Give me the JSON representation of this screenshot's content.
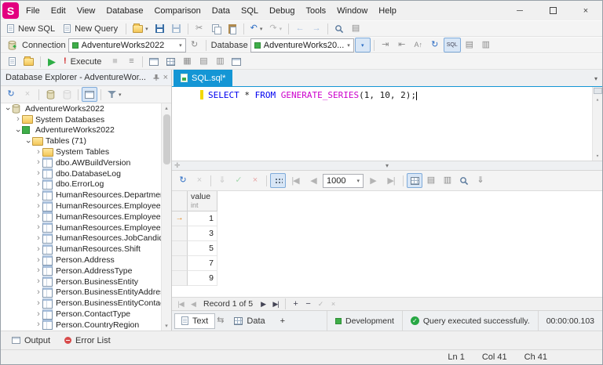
{
  "window": {
    "logo_text": "S",
    "menu_items": [
      "File",
      "Edit",
      "View",
      "Database",
      "Comparison",
      "Data",
      "SQL",
      "Debug",
      "Tools",
      "Window",
      "Help"
    ]
  },
  "icons": {
    "dropdown": "▾",
    "up": "▴",
    "chevron": "›",
    "refresh": "↻",
    "undo": "↶",
    "redo": "↷",
    "cut": "✂",
    "back": "←",
    "forward": "→",
    "play": "▶",
    "exclamation": "!",
    "lines": "≡",
    "stop": "■",
    "indent": "⇥",
    "outdent": "⇤",
    "uppercase": "A↑",
    "win1": "▦",
    "win2": "▤",
    "win3": "▥",
    "export": "⇓",
    "first": "|◀",
    "prev": "◀",
    "next": "▶",
    "last": "▶|",
    "plus": "+",
    "minus": "−",
    "check": "✓",
    "cross": "×",
    "minimize": "─",
    "swap": "⇆",
    "current_row": "→",
    "pin": "-□",
    "splitter_handle": "✛"
  },
  "colors": {
    "brand_pink": "#e3007f",
    "accent_tab_blue": "#1496d5",
    "status_green": "#3fae49",
    "keyword_blue": "#0000f0",
    "function_magenta": "#cc00cc",
    "changebar_yellow": "#f2d800"
  },
  "toolbars": {
    "new_sql": "New SQL",
    "new_query": "New Query",
    "connection_label": "Connection",
    "connection_value": "AdventureWorks2022",
    "database_label": "Database",
    "database_value": "AdventureWorks20...",
    "execute_label": "Execute",
    "sql_button": "SQL"
  },
  "explorer": {
    "title": "Database Explorer - AdventureWor...",
    "tree": [
      {
        "label": "AdventureWorks2022",
        "level": 0,
        "icon": "server",
        "state": "expanded"
      },
      {
        "label": "System Databases",
        "level": 1,
        "icon": "folder",
        "state": "collapsed"
      },
      {
        "label": "AdventureWorks2022",
        "level": 1,
        "icon": "database",
        "state": "expanded"
      },
      {
        "label": "Tables (71)",
        "level": 2,
        "icon": "folder",
        "state": "expanded"
      },
      {
        "label": "System Tables",
        "level": 3,
        "icon": "folder",
        "state": "collapsed"
      },
      {
        "label": "dbo.AWBuildVersion",
        "level": 3,
        "icon": "table",
        "state": "collapsed"
      },
      {
        "label": "dbo.DatabaseLog",
        "level": 3,
        "icon": "table",
        "state": "collapsed"
      },
      {
        "label": "dbo.ErrorLog",
        "level": 3,
        "icon": "table",
        "state": "collapsed"
      },
      {
        "label": "HumanResources.Department",
        "level": 3,
        "icon": "table",
        "state": "collapsed"
      },
      {
        "label": "HumanResources.Employee",
        "level": 3,
        "icon": "table",
        "state": "collapsed"
      },
      {
        "label": "HumanResources.EmployeeDepartm",
        "level": 3,
        "icon": "table",
        "state": "collapsed"
      },
      {
        "label": "HumanResources.EmployeePayHisto",
        "level": 3,
        "icon": "table",
        "state": "collapsed"
      },
      {
        "label": "HumanResources.JobCandidate",
        "level": 3,
        "icon": "table",
        "state": "collapsed"
      },
      {
        "label": "HumanResources.Shift",
        "level": 3,
        "icon": "table",
        "state": "collapsed"
      },
      {
        "label": "Person.Address",
        "level": 3,
        "icon": "table",
        "state": "collapsed"
      },
      {
        "label": "Person.AddressType",
        "level": 3,
        "icon": "table",
        "state": "collapsed"
      },
      {
        "label": "Person.BusinessEntity",
        "level": 3,
        "icon": "table",
        "state": "collapsed"
      },
      {
        "label": "Person.BusinessEntityAddress",
        "level": 3,
        "icon": "table",
        "state": "collapsed"
      },
      {
        "label": "Person.BusinessEntityContact",
        "level": 3,
        "icon": "table",
        "state": "collapsed"
      },
      {
        "label": "Person.ContactType",
        "level": 3,
        "icon": "table",
        "state": "collapsed"
      },
      {
        "label": "Person.CountryRegion",
        "level": 3,
        "icon": "table",
        "state": "collapsed"
      }
    ]
  },
  "editor": {
    "tab_label": "SQL.sql*",
    "code_tokens": [
      {
        "text": "SELECT",
        "type": "keyword"
      },
      {
        "text": " * ",
        "type": "plain"
      },
      {
        "text": "FROM",
        "type": "keyword"
      },
      {
        "text": " ",
        "type": "plain"
      },
      {
        "text": "GENERATE_SERIES",
        "type": "function"
      },
      {
        "text": "(",
        "type": "plain"
      },
      {
        "text": "1",
        "type": "number"
      },
      {
        "text": ", ",
        "type": "plain"
      },
      {
        "text": "10",
        "type": "number"
      },
      {
        "text": ", ",
        "type": "plain"
      },
      {
        "text": "2",
        "type": "number"
      },
      {
        "text": ");",
        "type": "plain"
      }
    ]
  },
  "results": {
    "page_size": "1000",
    "grid": {
      "column": {
        "name": "value",
        "type": "int"
      },
      "rows": [
        "1",
        "3",
        "5",
        "7",
        "9"
      ]
    },
    "record_status": "Record 1 of 5",
    "tabs": {
      "text": "Text",
      "data": "Data",
      "add": "+"
    }
  },
  "status": {
    "environment": "Development",
    "message": "Query executed successfully.",
    "duration": "00:00:00.103",
    "ln": "Ln 1",
    "col": "Col 41",
    "ch": "Ch 41"
  },
  "bottom_panel": {
    "output": "Output",
    "error_list": "Error List"
  }
}
